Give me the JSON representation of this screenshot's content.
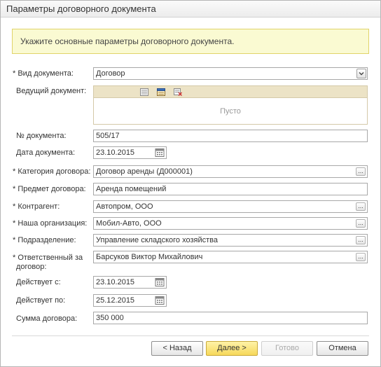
{
  "window": {
    "title": "Параметры договорного документа"
  },
  "hint": "Укажите основные параметры договорного документа.",
  "form": {
    "doc_type": {
      "label": "* Вид документа:",
      "value": "Договор"
    },
    "lead_doc": {
      "label": "Ведущий документ:",
      "empty_text": "Пусто"
    },
    "doc_number": {
      "label": "№ документа:",
      "value": "505/17"
    },
    "doc_date": {
      "label": "Дата документа:",
      "value": "23.10.2015"
    },
    "category": {
      "label": "* Категория договора:",
      "value": "Договор аренды (Д000001)"
    },
    "subject": {
      "label": "* Предмет договора:",
      "value": "Аренда помещений"
    },
    "counterparty": {
      "label": "* Контрагент:",
      "value": "Автопром, ООО"
    },
    "organization": {
      "label": "* Наша организация:",
      "value": "Мобил-Авто, ООО"
    },
    "department": {
      "label": "* Подразделение:",
      "value": "Управление складского хозяйства"
    },
    "responsible": {
      "label_line1": "* Ответственный за",
      "label_line2": "договор:",
      "value": "Барсуков Виктор Михайлович"
    },
    "valid_from": {
      "label": "Действует с:",
      "value": "23.10.2015"
    },
    "valid_to": {
      "label": "Действует по:",
      "value": "25.12.2015"
    },
    "amount": {
      "label": "Сумма договора:",
      "value": "350 000"
    }
  },
  "buttons": {
    "back": "< Назад",
    "next": "Далее >",
    "done": "Готово",
    "cancel": "Отмена"
  },
  "inline_button_glyph": "...",
  "colors": {
    "hint_bg": "#fafad2",
    "primary_button": "#f6d85a",
    "lead_toolbar": "#ece3c6"
  }
}
